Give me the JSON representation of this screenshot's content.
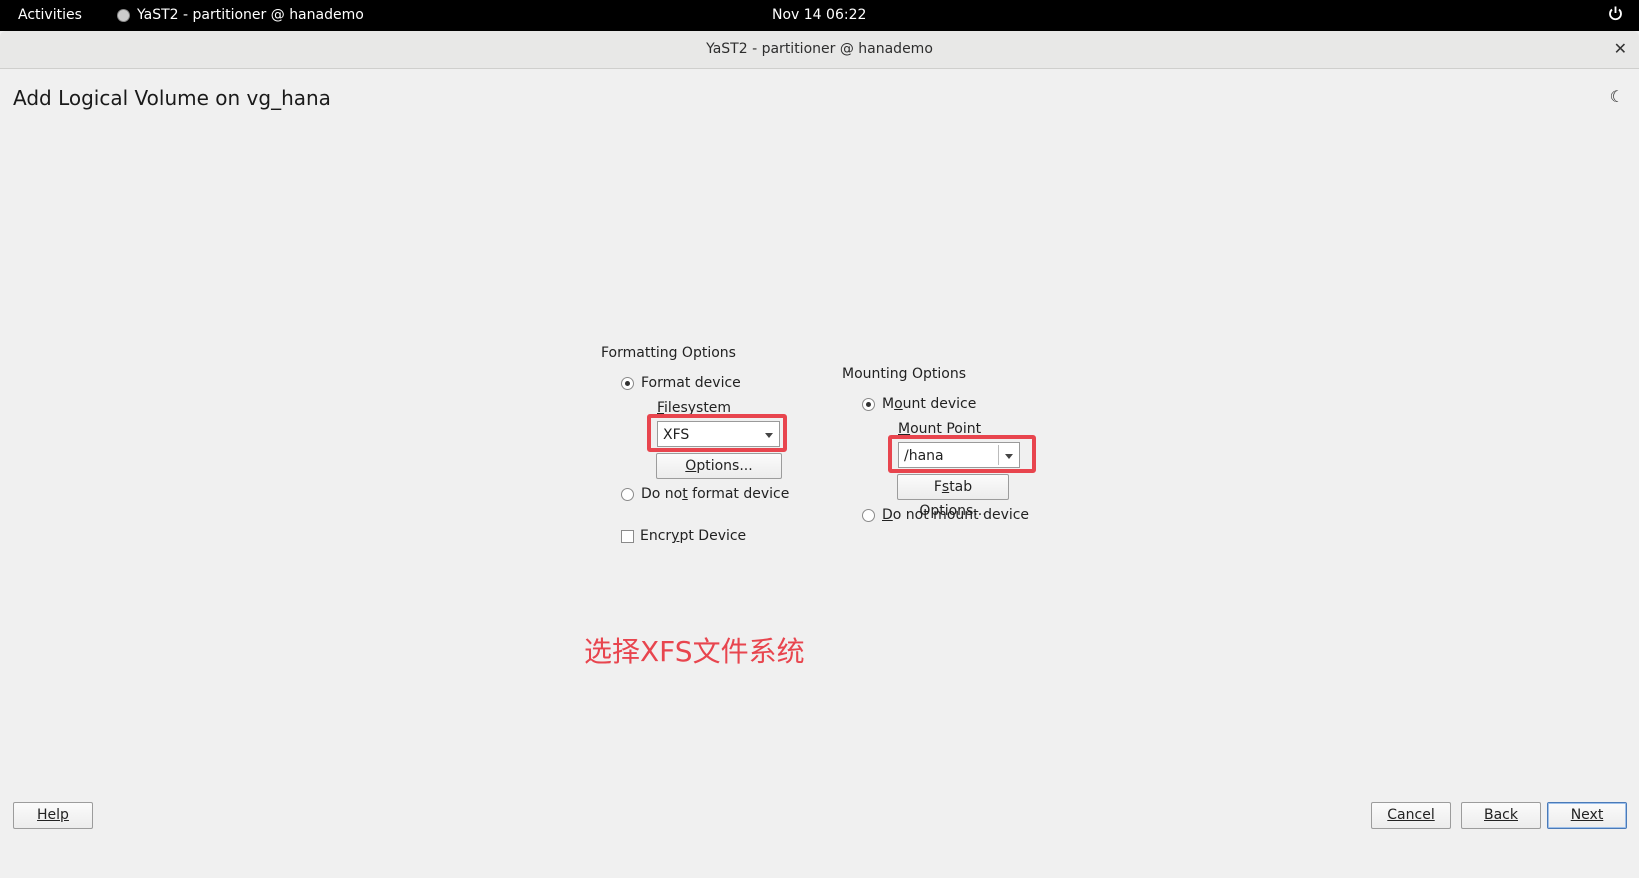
{
  "topbar": {
    "activities": "Activities",
    "app_name": "YaST2 - partitioner @ hanademo",
    "clock": "Nov 14  06:22",
    "power_icon": "power-icon"
  },
  "window": {
    "title": "YaST2 - partitioner @ hanademo",
    "close": "✕"
  },
  "page": {
    "heading": "Add Logical Volume on vg_hana",
    "theme_icon": "☾"
  },
  "formatting": {
    "group_label": "Formatting Options",
    "format_device": "Format device",
    "filesystem_label_pre": "",
    "filesystem_label_u": "F",
    "filesystem_label_post": "ilesystem",
    "filesystem_value": "XFS",
    "options_pre": "O",
    "options_post": "ptions...",
    "do_not_format_pre": "Do no",
    "do_not_format_u": "t",
    "do_not_format_post": " format device",
    "format_selected": true,
    "encrypt_pre": "Encr",
    "encrypt_u": "y",
    "encrypt_post": "pt Device",
    "encrypt_checked": false
  },
  "mounting": {
    "group_label": "Mounting Options",
    "mount_device_pre": "M",
    "mount_device_u": "o",
    "mount_device_post": "unt device",
    "mount_point_label_pre": "M",
    "mount_point_label_post": "ount Point",
    "mount_point_value": "/hana",
    "fstab_pre": "F",
    "fstab_u": "s",
    "fstab_post": "tab Options...",
    "do_not_mount_pre": "D",
    "do_not_mount_post": "o not mount device",
    "mount_selected": true
  },
  "annotation": "选择XFS文件系统",
  "footer": {
    "help": "Help",
    "cancel": "Cancel",
    "back": "Back",
    "next": "Next"
  },
  "colors": {
    "highlight": "#e8454e",
    "topbar": "#000000",
    "background": "#f0f0f0"
  }
}
